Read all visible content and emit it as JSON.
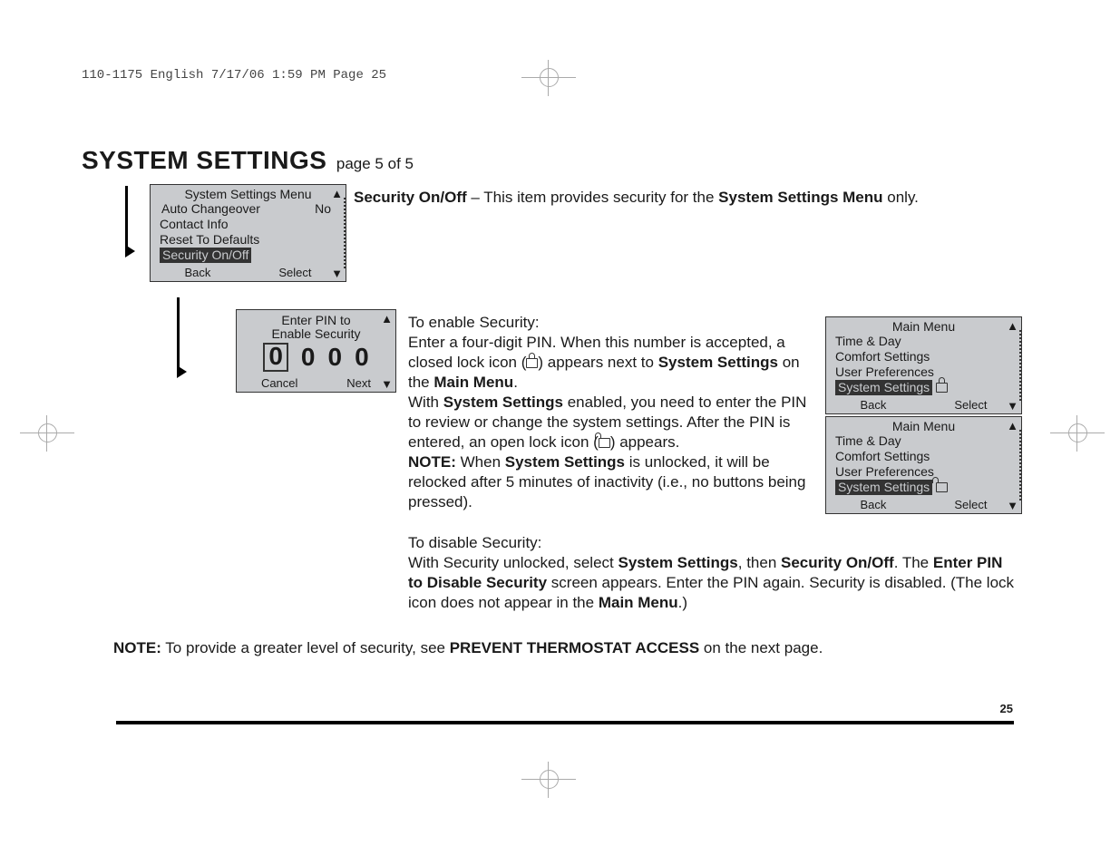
{
  "running_header": "110-1175 English  7/17/06  1:59 PM  Page 25",
  "heading": "SYSTEM SETTINGS",
  "heading_page": "page 5 of 5",
  "lcd_settings": {
    "title": "System Settings Menu",
    "items": [
      "Auto Changeover",
      "Contact Info",
      "Reset To Defaults"
    ],
    "item0_value": "No",
    "selected": "Security On/Off",
    "back": "Back",
    "select": "Select"
  },
  "lcd_pin": {
    "title_line1": "Enter PIN to",
    "title_line2": "Enable Security",
    "d0": "0",
    "d1": "0",
    "d2": "0",
    "d3": "0",
    "cancel": "Cancel",
    "next": "Next"
  },
  "lcd_main_locked": {
    "title": "Main Menu",
    "items": [
      "Time & Day",
      "Comfort Settings",
      "User Preferences"
    ],
    "selected": "System Settings",
    "back": "Back",
    "select": "Select"
  },
  "lcd_main_unlocked": {
    "title": "Main Menu",
    "items": [
      "Time & Day",
      "Comfort Settings",
      "User Preferences"
    ],
    "selected": "System Settings",
    "back": "Back",
    "select": "Select"
  },
  "para_top_a": "Security On/Off",
  "para_top_b": " – This item provides security for the ",
  "para_top_c": "System Settings Menu",
  "para_top_d": " only.",
  "enable_h": "To enable Security:",
  "enable_p1a": "Enter a four-digit PIN. When this number is accepted, a closed lock icon (",
  "enable_p1b": ") appears next to ",
  "enable_p1c": "System Settings",
  "enable_p1d": " on the ",
  "enable_p1e": "Main Menu",
  "enable_p1f": ".",
  "enable_p2a": "With ",
  "enable_p2b": "System Settings",
  "enable_p2c": " enabled, you need to enter the PIN to review or change the system settings. After the PIN is entered, an open lock icon (",
  "enable_p2d": ") appears.",
  "enable_note_a": "NOTE:",
  "enable_note_b": " When ",
  "enable_note_c": "System Settings",
  "enable_note_d": " is unlocked, it will be relocked after 5 minutes of inactivity (i.e., no buttons being pressed).",
  "disable_h": "To disable Security:",
  "disable_p_a": "With Security unlocked, select ",
  "disable_p_b": "System Settings",
  "disable_p_c": ", then ",
  "disable_p_d": "Security On/Off",
  "disable_p_e": ". The ",
  "disable_p_f": "Enter PIN to Disable Security",
  "disable_p_g": " screen appears. Enter the PIN again. Security is disabled. (The lock icon does not appear in the ",
  "disable_p_h": "Main Menu",
  "disable_p_i": ".)",
  "bottom_note_a": "NOTE:",
  "bottom_note_b": " To provide a greater level of security, see ",
  "bottom_note_c": "PREVENT THERMOSTAT ACCESS",
  "bottom_note_d": " on the next page.",
  "page_number": "25"
}
